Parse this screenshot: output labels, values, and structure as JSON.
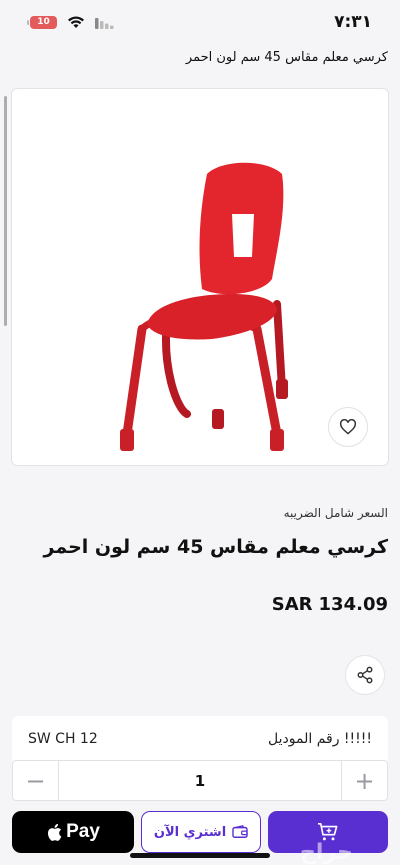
{
  "status_bar": {
    "time": "٧:٣١",
    "battery": "10"
  },
  "header": {
    "title": "كرسي معلم مقاس 45 سم لون احمر"
  },
  "product": {
    "tax_note": "السعر شامل الضريبه",
    "name": "كرسي معلم مقاس 45 سم لون احمر",
    "price_currency": "SAR",
    "price_value": "134.09",
    "image_color": "#e3262e"
  },
  "details": {
    "model_label": "!!!!! رقم الموديل",
    "model_value": "SW CH 12"
  },
  "quantity": {
    "value": "1",
    "minus": "−",
    "plus": "+"
  },
  "actions": {
    "apple_pay_label": "Pay",
    "buy_now_label": "اشتري الآن",
    "cart_icon": "cart-icon"
  },
  "colors": {
    "accent": "#5a2fd1",
    "background": "#f5f5f7"
  },
  "watermark": "حراج"
}
